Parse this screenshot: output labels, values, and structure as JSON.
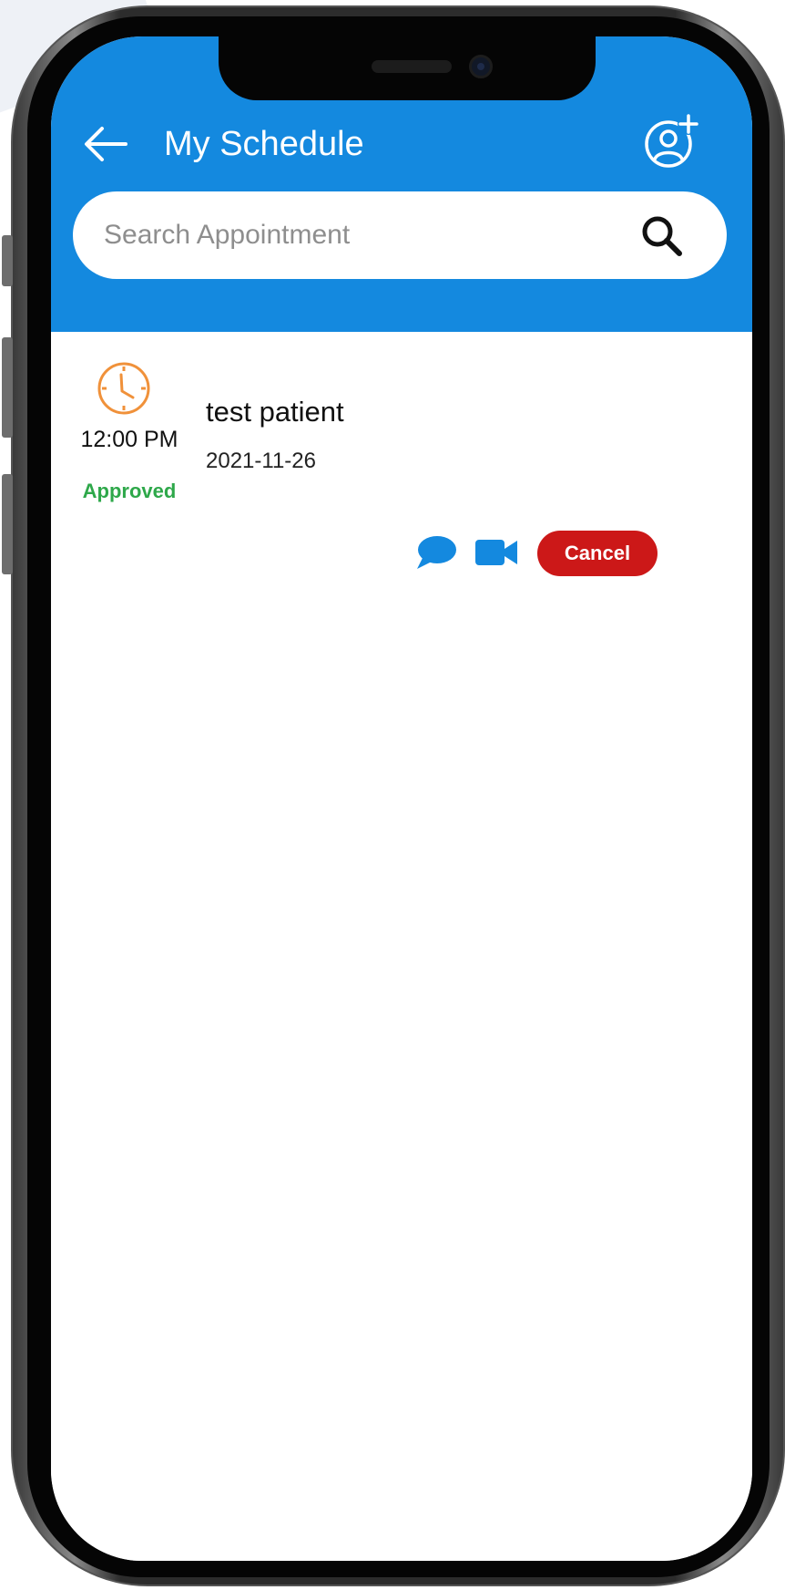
{
  "header": {
    "title": "My Schedule",
    "back_icon": "arrow-left-icon",
    "add_icon": "add-user-icon",
    "color": "#1489df"
  },
  "search": {
    "placeholder": "Search Appointment",
    "value": "",
    "icon": "search-icon"
  },
  "appointments": [
    {
      "time": "12:00 PM",
      "status": "Approved",
      "status_color": "#2ea84a",
      "patient": "test patient",
      "date": "2021-11-26",
      "clock_icon": "clock-icon",
      "clock_color": "#f0913a",
      "actions": {
        "chat_icon": "chat-bubble-icon",
        "video_icon": "video-camera-icon",
        "cancel_label": "Cancel",
        "cancel_color": "#cc1818"
      }
    }
  ]
}
